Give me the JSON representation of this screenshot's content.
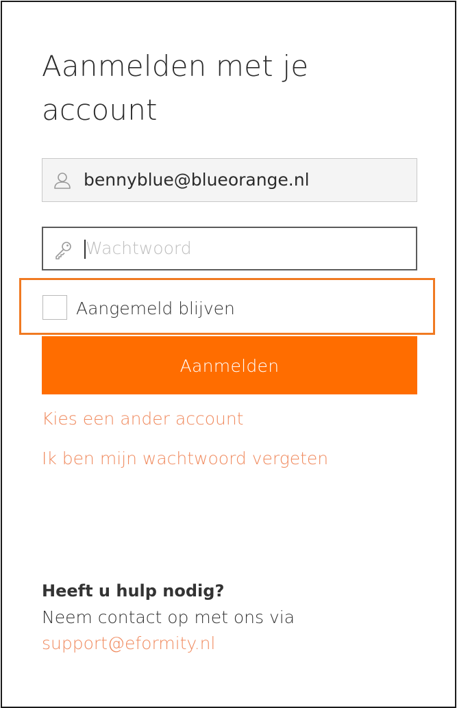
{
  "login": {
    "title": "Aanmelden met je account",
    "username": {
      "value": "bennyblue@blueorange.nl",
      "icon": "user-icon"
    },
    "password": {
      "placeholder": "Wachtwoord",
      "icon": "key-icon"
    },
    "remember": {
      "label": "Aangemeld blijven",
      "checked": false
    },
    "submit_label": "Aanmelden",
    "links": {
      "other_account": "Kies een ander account",
      "forgot_password": "Ik ben mijn wachtwoord vergeten"
    }
  },
  "help": {
    "heading": "Heeft u hulp nodig?",
    "text": "Neem contact op met ons via",
    "email": "support@eformity.nl"
  },
  "colors": {
    "accent": "#ff6d00",
    "link": "#f08a5e",
    "highlight_border": "#f07a22",
    "text": "#333333"
  }
}
